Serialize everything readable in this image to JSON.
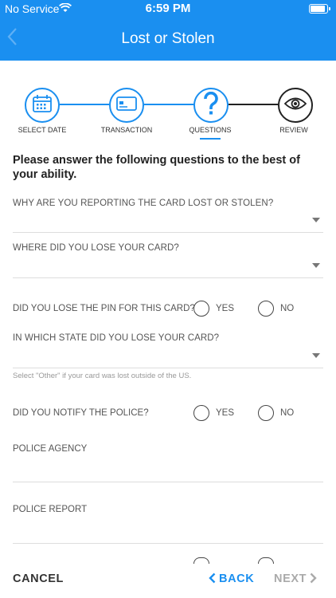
{
  "status_bar": {
    "carrier": "No Service",
    "time": "6:59 PM"
  },
  "nav": {
    "title": "Lost or Stolen",
    "back_icon": "chevron-left-icon"
  },
  "steps": [
    {
      "label": "SELECT DATE",
      "icon": "calendar-icon"
    },
    {
      "label": "TRANSACTION",
      "icon": "card-icon"
    },
    {
      "label": "QUESTIONS",
      "icon": "question-icon"
    },
    {
      "label": "REVIEW",
      "icon": "eye-icon"
    }
  ],
  "intro": "Please answer the following questions to the best of your ability.",
  "fields": {
    "why_reporting": "WHY ARE YOU REPORTING THE CARD LOST OR STOLEN?",
    "where_lost": "WHERE DID YOU LOSE YOUR CARD?",
    "lost_pin": "DID YOU LOSE THE PIN FOR THIS CARD?",
    "which_state": "IN WHICH STATE DID YOU LOSE YOUR CARD?",
    "state_hint": "Select \"Other\" if your card was lost outside of the US.",
    "notify_police": "DID YOU NOTIFY THE POLICE?",
    "police_agency": "POLICE AGENCY",
    "police_report": "POLICE REPORT"
  },
  "radio_options": {
    "yes": "YES",
    "no": "NO"
  },
  "footer": {
    "cancel": "CANCEL",
    "back": "BACK",
    "next": "NEXT"
  },
  "colors": {
    "primary": "#1a8ff0",
    "disabled": "#aaaaaa"
  }
}
